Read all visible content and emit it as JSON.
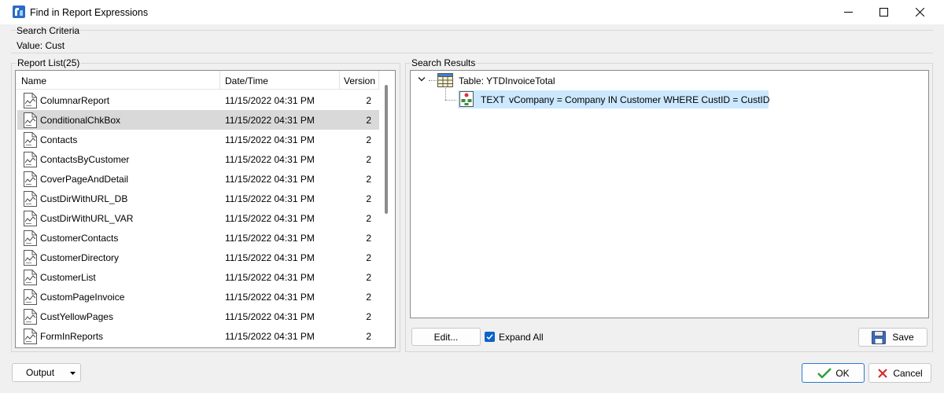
{
  "window": {
    "title": "Find in Report Expressions",
    "minimize_icon": "minimize-icon",
    "maximize_icon": "maximize-icon",
    "close_icon": "close-icon"
  },
  "search_criteria": {
    "label": "Search Criteria",
    "value_text": "Value: Cust"
  },
  "report_list": {
    "label": "Report List(25)",
    "columns": {
      "name": "Name",
      "date": "Date/Time",
      "version": "Version"
    },
    "rows": [
      {
        "name": "ColumnarReport",
        "date": "11/15/2022 04:31 PM",
        "version": "2"
      },
      {
        "name": "ConditionalChkBox",
        "date": "11/15/2022 04:31 PM",
        "version": "2"
      },
      {
        "name": "Contacts",
        "date": "11/15/2022 04:31 PM",
        "version": "2"
      },
      {
        "name": "ContactsByCustomer",
        "date": "11/15/2022 04:31 PM",
        "version": "2"
      },
      {
        "name": "CoverPageAndDetail",
        "date": "11/15/2022 04:31 PM",
        "version": "2"
      },
      {
        "name": "CustDirWithURL_DB",
        "date": "11/15/2022 04:31 PM",
        "version": "2"
      },
      {
        "name": "CustDirWithURL_VAR",
        "date": "11/15/2022 04:31 PM",
        "version": "2"
      },
      {
        "name": "CustomerContacts",
        "date": "11/15/2022 04:31 PM",
        "version": "2"
      },
      {
        "name": "CustomerDirectory",
        "date": "11/15/2022 04:31 PM",
        "version": "2"
      },
      {
        "name": "CustomerList",
        "date": "11/15/2022 04:31 PM",
        "version": "2"
      },
      {
        "name": "CustomPageInvoice",
        "date": "11/15/2022 04:31 PM",
        "version": "2"
      },
      {
        "name": "CustYellowPages",
        "date": "11/15/2022 04:31 PM",
        "version": "2"
      },
      {
        "name": "FormInReports",
        "date": "11/15/2022 04:31 PM",
        "version": "2"
      }
    ],
    "selected_index": 1,
    "row_icon": "report-document-icon"
  },
  "search_results": {
    "label": "Search Results",
    "table_node": {
      "label": "Table: YTDInvoiceTotal",
      "icon": "table-grid-icon"
    },
    "child_node": {
      "type": "TEXT",
      "expression": "vCompany = Company IN Customer WHERE CustID = CustID",
      "icon": "text-component-icon"
    }
  },
  "buttons": {
    "edit": "Edit...",
    "expand_all": "Expand All",
    "expand_all_checked": true,
    "save": "Save",
    "output": "Output",
    "ok": "OK",
    "cancel": "Cancel"
  },
  "colors": {
    "selection_highlight": "#cce8ff",
    "list_selection": "#d9d9d9",
    "checkbox_accent": "#0a64c8",
    "ok_check": "#2e9e3a",
    "cancel_x": "#d32b2b"
  }
}
